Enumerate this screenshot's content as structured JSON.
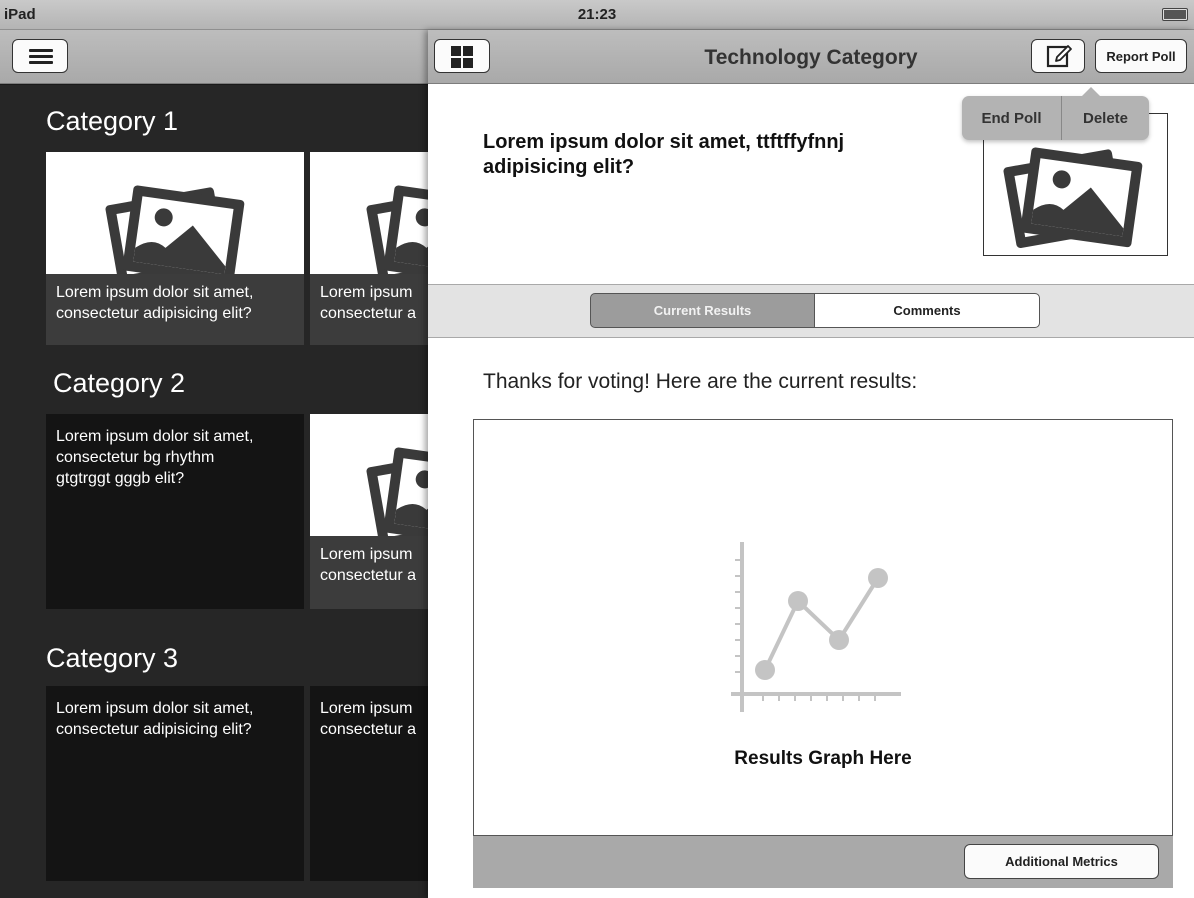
{
  "status_bar": {
    "device": "iPad",
    "time": "21:23"
  },
  "left": {
    "categories": [
      {
        "title": "Category 1",
        "tiles": [
          {
            "caption": "Lorem ipsum dolor sit amet, consectetur adipisicing elit?",
            "line1": "Lorem ipsum dolor sit amet,",
            "line2": "consectetur adipisicing elit?"
          },
          {
            "line1": "Lorem ipsum",
            "line2": "consectetur a"
          }
        ]
      },
      {
        "title": "Category 2",
        "tiles": [
          {
            "line1": "Lorem ipsum dolor sit amet,",
            "line2": "consectetur bg rhythm",
            "line3": "gtgtrggt gggb elit?"
          },
          {
            "line1": "Lorem ipsum",
            "line2": "consectetur a"
          }
        ]
      },
      {
        "title": "Category 3",
        "tiles": [
          {
            "line1": "Lorem ipsum dolor sit amet,",
            "line2": "consectetur adipisicing elit?"
          },
          {
            "line1": "Lorem ipsum",
            "line2": "consectetur a"
          }
        ]
      }
    ]
  },
  "right": {
    "title": "Technology Category",
    "report_label": "Report Poll",
    "question_line1": "Lorem ipsum dolor sit amet, ttftffyfnnj",
    "question_line2": "adipisicing elit?",
    "popover": {
      "end_poll": "End Poll",
      "delete": "Delete"
    },
    "tabs": {
      "current": "Current Results",
      "comments": "Comments"
    },
    "thanks": "Thanks for voting! Here are the current results:",
    "graph_label": "Results Graph Here",
    "metrics_label": "Additional Metrics"
  },
  "icons": [
    "menu-icon",
    "grid-icon",
    "edit-icon",
    "photo-icon",
    "line-chart-icon",
    "battery-icon"
  ]
}
